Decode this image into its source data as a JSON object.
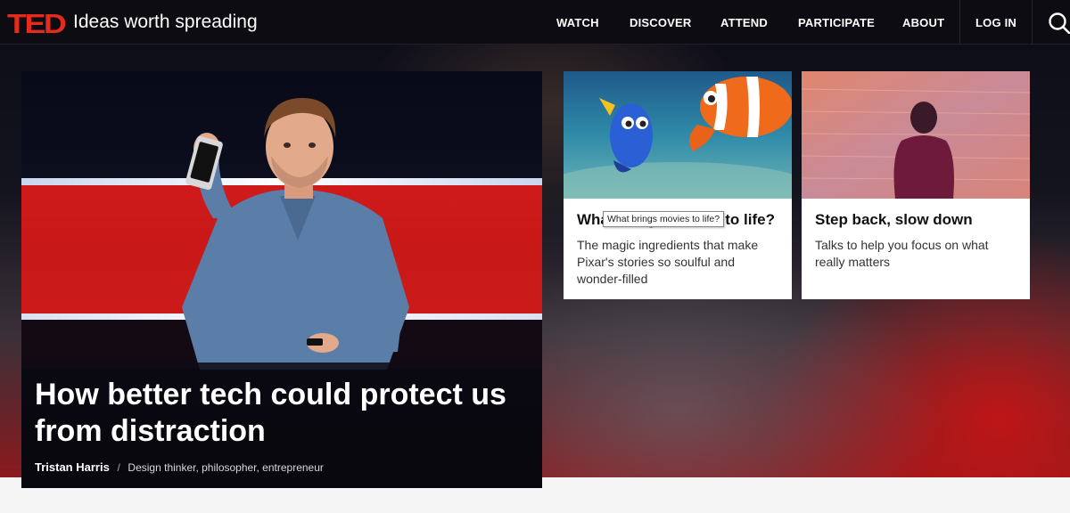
{
  "header": {
    "logo": "TED",
    "tagline": "Ideas worth spreading",
    "nav": [
      "WATCH",
      "DISCOVER",
      "ATTEND",
      "PARTICIPATE",
      "ABOUT"
    ],
    "login": "LOG IN",
    "search_icon": "search-icon"
  },
  "colors": {
    "brand": "#e62b1e",
    "header_bg": "#0c0c12"
  },
  "feature": {
    "title": "How better tech could protect us from distraction",
    "speaker": "Tristan Harris",
    "separator": "/",
    "description": "Design thinker, philosopher, entrepreneur"
  },
  "cards": [
    {
      "title": "What brings movies to life?",
      "desc": "The magic ingredients that make Pixar's stories so soulful and wonder-filled"
    },
    {
      "title": "Step back, slow down",
      "desc": "Talks to help you focus on what really matters"
    }
  ],
  "tooltip": "What brings movies to life?"
}
